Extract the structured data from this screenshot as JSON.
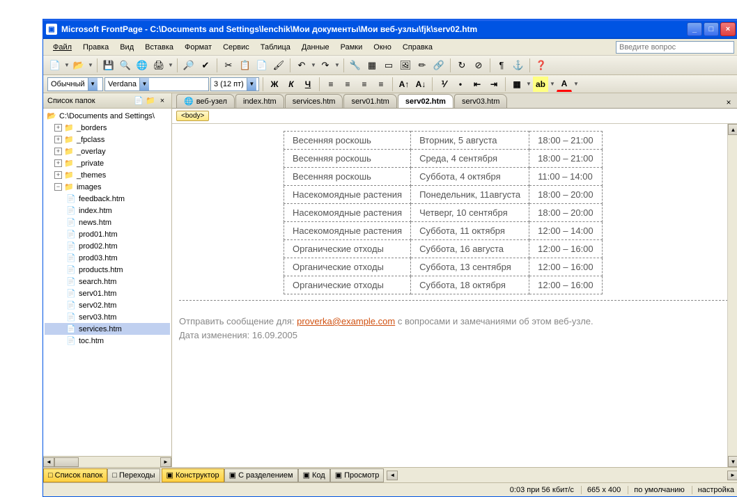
{
  "window": {
    "title": "Microsoft FrontPage - C:\\Documents and Settings\\lenchik\\Мои документы\\Мои веб-узлы\\fjk\\serv02.htm"
  },
  "menu": {
    "items": [
      "Файл",
      "Правка",
      "Вид",
      "Вставка",
      "Формат",
      "Сервис",
      "Таблица",
      "Данные",
      "Рамки",
      "Окно",
      "Справка"
    ],
    "search_placeholder": "Введите вопрос"
  },
  "format": {
    "style": "Обычный",
    "font": "Verdana",
    "size": "3 (12 пт)"
  },
  "folder_panel": {
    "title": "Список папок",
    "root": "C:\\Documents and Settings\\",
    "folders": [
      "_borders",
      "_fpclass",
      "_overlay",
      "_private",
      "_themes",
      "images"
    ],
    "files": [
      "feedback.htm",
      "index.htm",
      "news.htm",
      "prod01.htm",
      "prod02.htm",
      "prod03.htm",
      "products.htm",
      "search.htm",
      "serv01.htm",
      "serv02.htm",
      "serv03.htm",
      "services.htm",
      "toc.htm"
    ],
    "selected_file": "services.htm"
  },
  "tabs": {
    "items": [
      "веб-узел",
      "index.htm",
      "services.htm",
      "serv01.htm",
      "serv02.htm",
      "serv03.htm"
    ],
    "active": "serv02.htm"
  },
  "breadcrumb": {
    "tag": "<body>"
  },
  "table_rows": [
    {
      "c0": "Весенняя роскошь",
      "c1": "Вторник, 5 августа",
      "c2": "18:00 – 21:00"
    },
    {
      "c0": "Весенняя роскошь",
      "c1": "Среда, 4 сентября",
      "c2": "18:00 – 21:00"
    },
    {
      "c0": "Весенняя роскошь",
      "c1": "Суббота, 4 октября",
      "c2": "11:00 – 14:00"
    },
    {
      "c0": "Насекомоядные растения",
      "c1": "Понедельник, 11августа",
      "c2": "18:00 – 20:00"
    },
    {
      "c0": "Насекомоядные растения",
      "c1": "Четверг, 10 сентября",
      "c2": "18:00 – 20:00"
    },
    {
      "c0": "Насекомоядные растения",
      "c1": "Суббота, 11 октября",
      "c2": "12:00 – 14:00"
    },
    {
      "c0": "Органические отходы",
      "c1": "Суббота, 16 августа",
      "c2": "12:00 – 16:00"
    },
    {
      "c0": "Органические отходы",
      "c1": "Суббота, 13 сентября",
      "c2": "12:00 – 16:00"
    },
    {
      "c0": "Органические отходы",
      "c1": "Суббота, 18 октября",
      "c2": "12:00 – 16:00"
    }
  ],
  "footer": {
    "line1_before": "Отправить сообщение для: ",
    "email": "proverka@example.com",
    "line1_after": " с вопросами и замечаниями об этом веб-узле.",
    "line2": "Дата изменения: 16.09.2005"
  },
  "bottom_tabs": {
    "left": [
      "Список папок",
      "Переходы"
    ],
    "left_active": "Список папок",
    "views": [
      "Конструктор",
      "С разделением",
      "Код",
      "Просмотр"
    ],
    "views_active": "Конструктор"
  },
  "status": {
    "speed": "0:03 при 56 кбит/с",
    "dims": "665 x 400",
    "mode": "по умолчанию",
    "setup": "настройка"
  }
}
